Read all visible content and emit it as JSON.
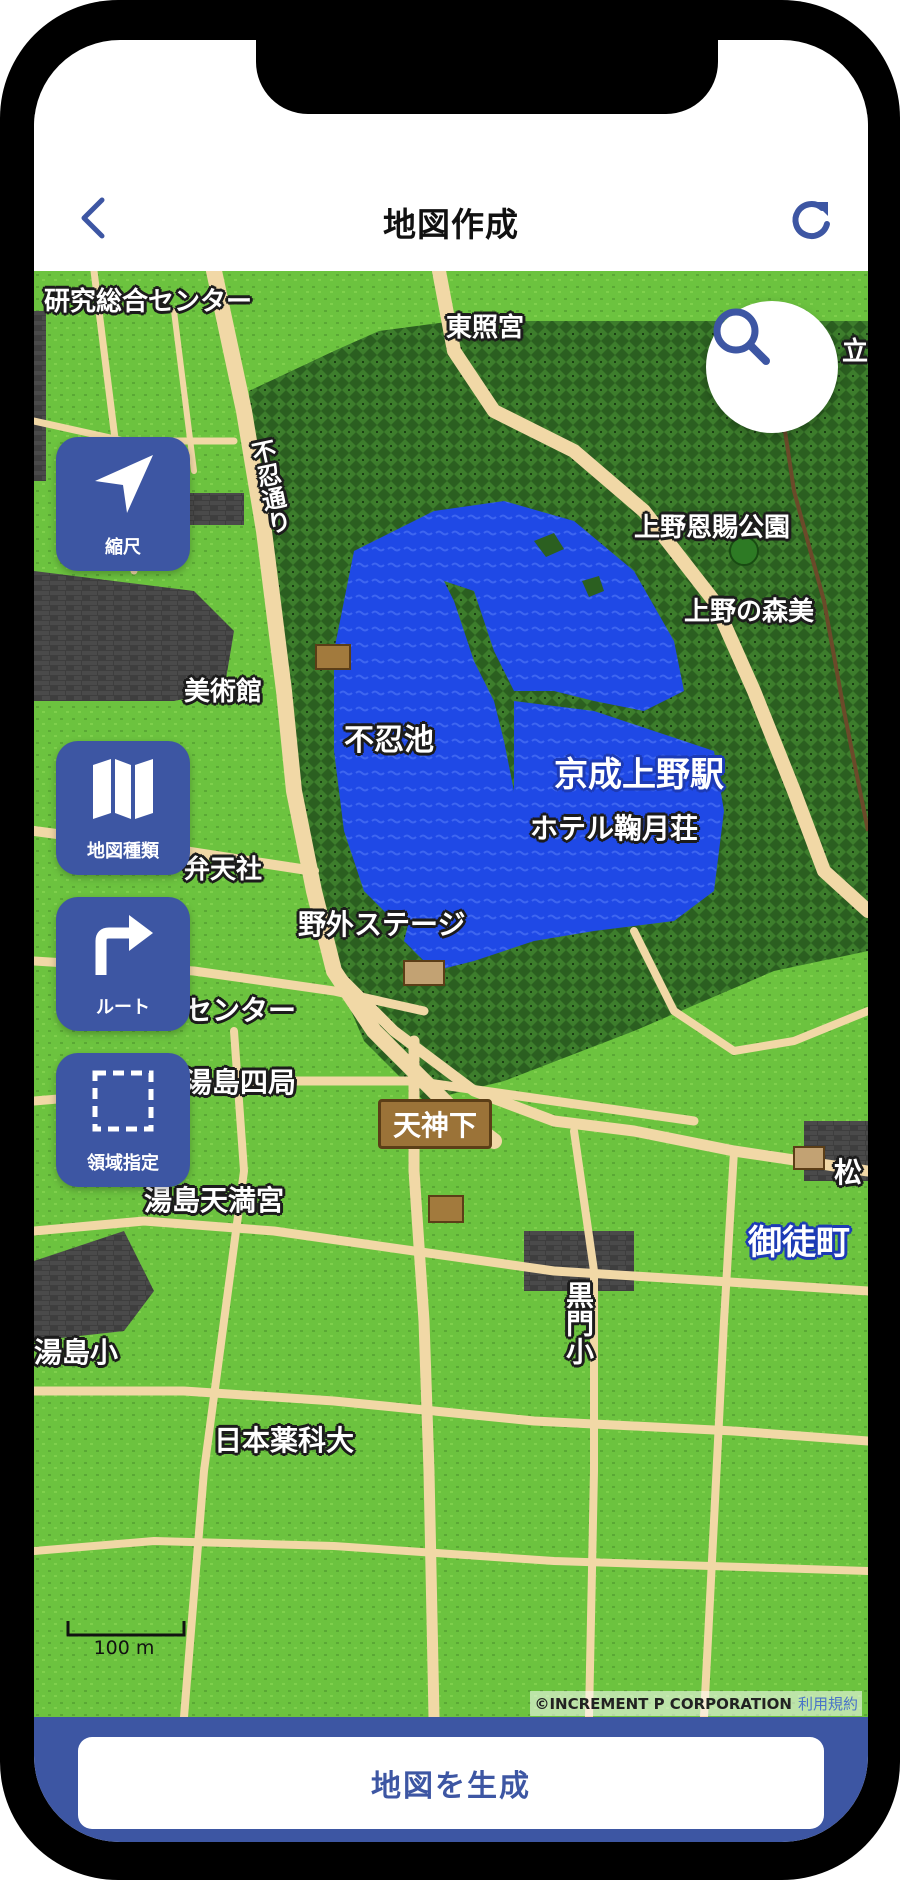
{
  "header": {
    "title": "地図作成",
    "back_icon": "chevron-left-icon",
    "reload_icon": "refresh-icon"
  },
  "map": {
    "search_icon": "search-icon",
    "labels": {
      "research_center": "研究総合センター",
      "toshogu": "東照宮",
      "ueno_park": "上野恩賜公園",
      "ueno_forest": "上野の森美",
      "shinobazu_dori": "不忍通り",
      "shinobazu_pond": "不忍池",
      "keisei_ueno": "京成上野駅",
      "hotel": "ホテル鞠月荘",
      "yagai_stage": "野外ステージ",
      "benten": "弁天社",
      "museum": "美術館",
      "center": "センター",
      "yushima_post": "湯島四局",
      "tenjinshita": "天神下",
      "yushima_tenmangu": "湯島天満宮",
      "okachimachi": "御徒町",
      "kuromon": "黒門小",
      "yushima_school": "湯島小",
      "nippon_yakka": "日本薬科大",
      "ritsu": "立",
      "matsu": "松"
    },
    "scale_label": "100 m",
    "copyright": "©INCREMENT P CORPORATION",
    "terms": "利用規約"
  },
  "side_buttons": [
    {
      "label": "縮尺",
      "icon": "navigation-arrow-icon"
    },
    {
      "label": "地図種類",
      "icon": "map-icon"
    },
    {
      "label": "ルート",
      "icon": "turn-right-arrow-icon"
    },
    {
      "label": "領域指定",
      "icon": "dashed-square-icon"
    }
  ],
  "bottom": {
    "generate_label": "地図を生成"
  },
  "colors": {
    "accent": "#3d56a3",
    "grass": "#6cc33f",
    "forest": "#2f6b22",
    "water": "#1f49e6",
    "road": "#f1d8a6",
    "building": "#3e3e3e"
  }
}
